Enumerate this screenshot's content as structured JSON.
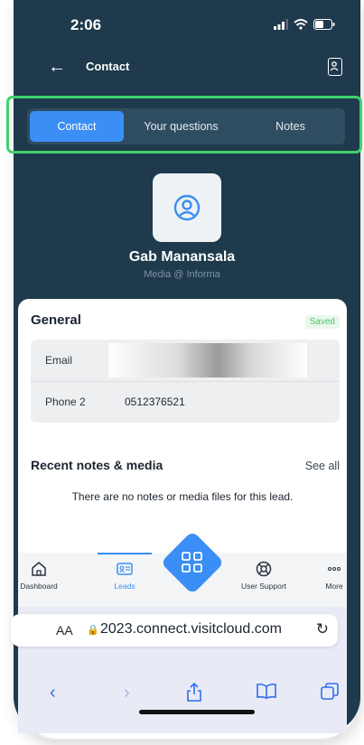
{
  "status": {
    "time": "2:06"
  },
  "header": {
    "title": "Contact"
  },
  "tabs": [
    {
      "label": "Contact"
    },
    {
      "label": "Your questions"
    },
    {
      "label": "Notes"
    }
  ],
  "profile": {
    "name": "Gab Manansala",
    "subtitle": "Media @ Informa"
  },
  "general": {
    "title": "General",
    "badge": "Saved",
    "rows": [
      {
        "label": "Email",
        "value": ""
      },
      {
        "label": "Phone 2",
        "value": "0512376521"
      }
    ]
  },
  "recent": {
    "title": "Recent notes & media",
    "see_all": "See all",
    "empty": "There are no notes or media files for this lead."
  },
  "nav": {
    "dashboard": "Dashboard",
    "leads": "Leads",
    "scan": "QR",
    "support": "User Support",
    "more": "More"
  },
  "browser": {
    "aa": "AA",
    "url": "2023.connect.visitcloud.com"
  },
  "colors": {
    "primary_bg": "#1e3a4c",
    "accent": "#3a8ef5",
    "highlight": "#3fd26b",
    "saved": "#4fc46a"
  }
}
